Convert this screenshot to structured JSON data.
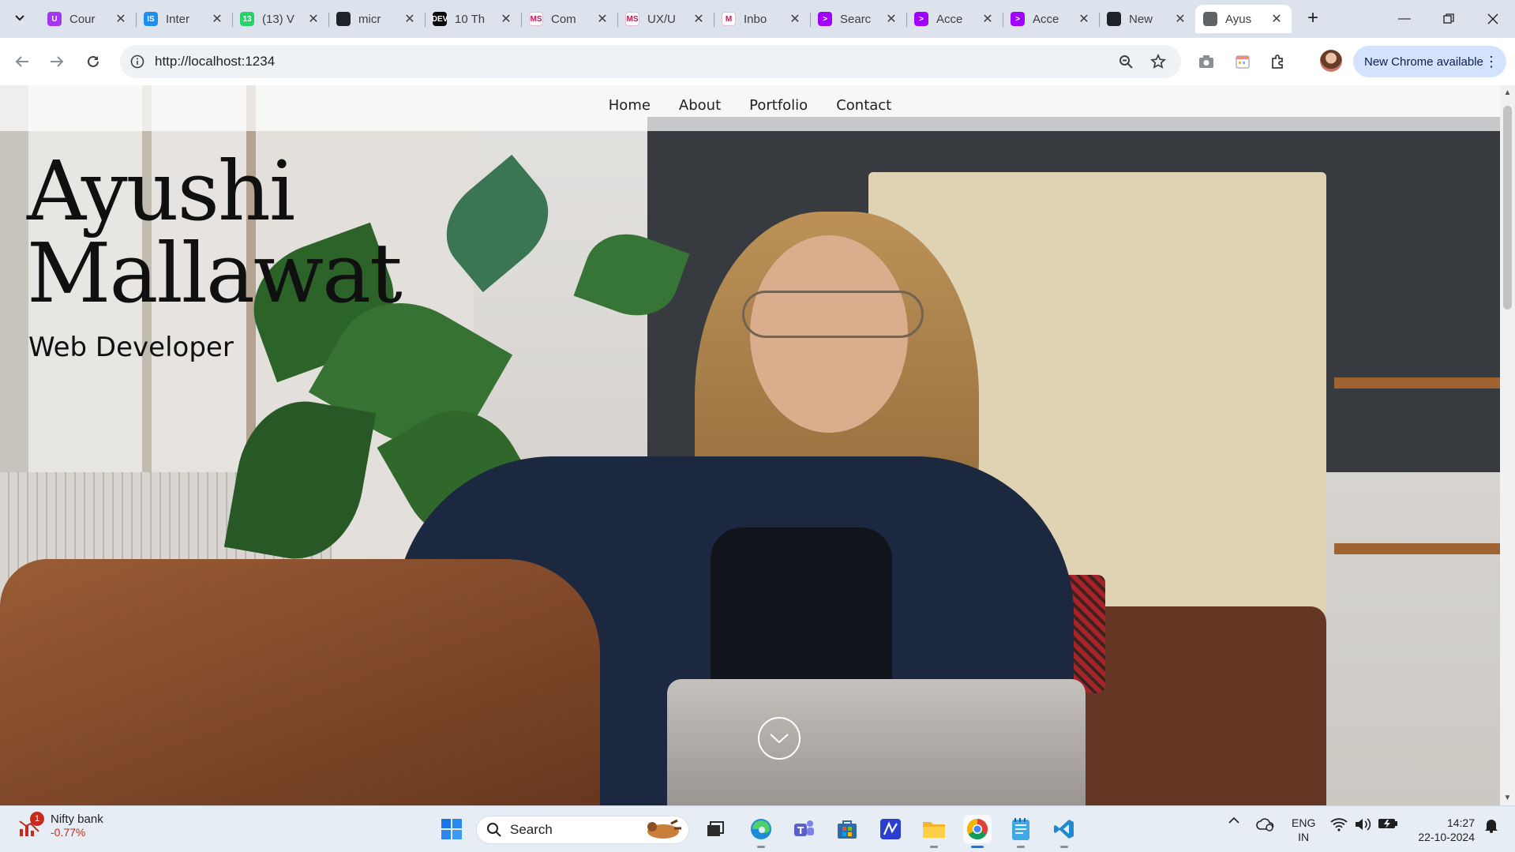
{
  "browser": {
    "tabs": [
      {
        "title": "Cour",
        "icon": "udemy-icon",
        "color": "#a435f0",
        "glyph": "U"
      },
      {
        "title": "Inter",
        "icon": "internshala-icon",
        "color": "#1b8ef0",
        "glyph": "IS"
      },
      {
        "title": "(13) V",
        "icon": "whatsapp-icon",
        "color": "#25d366",
        "glyph": "13"
      },
      {
        "title": "micr",
        "icon": "github-icon",
        "color": "#1f2328",
        "glyph": ""
      },
      {
        "title": "10 Th",
        "icon": "dev-icon",
        "color": "#0a0a0a",
        "glyph": "DEV"
      },
      {
        "title": "Com",
        "icon": "uxd-icon",
        "color": "#ffffff",
        "glyph": "MS"
      },
      {
        "title": "UX/U",
        "icon": "uxd-icon",
        "color": "#ffffff",
        "glyph": "MS"
      },
      {
        "title": "Inbo",
        "icon": "gmail-icon",
        "color": "#ffffff",
        "glyph": "M"
      },
      {
        "title": "Searc",
        "icon": "accenture-icon",
        "color": "#a100ff",
        "glyph": ">"
      },
      {
        "title": "Acce",
        "icon": "accenture-icon",
        "color": "#a100ff",
        "glyph": ">"
      },
      {
        "title": "Acce",
        "icon": "accenture-icon",
        "color": "#a100ff",
        "glyph": ">"
      },
      {
        "title": "New",
        "icon": "github-icon",
        "color": "#1f2328",
        "glyph": ""
      },
      {
        "title": "Ayus",
        "icon": "globe-icon",
        "color": "#5f6368",
        "glyph": "",
        "active": true
      }
    ],
    "url": "http://localhost:1234",
    "update_label": "New Chrome available"
  },
  "page": {
    "nav": [
      "Home",
      "About",
      "Portfolio",
      "Contact"
    ],
    "name_line1": "Ayushi",
    "name_line2": "Mallawat",
    "role": "Web Developer"
  },
  "taskbar": {
    "widget_name": "Nifty bank",
    "widget_value": "-0.77%",
    "widget_badge": "1",
    "search_label": "Search",
    "lang_line1": "ENG",
    "lang_line2": "IN",
    "time": "14:27",
    "date": "22-10-2024"
  },
  "colors": {
    "accent": "#1a73e8",
    "negative": "#c42b1c"
  }
}
